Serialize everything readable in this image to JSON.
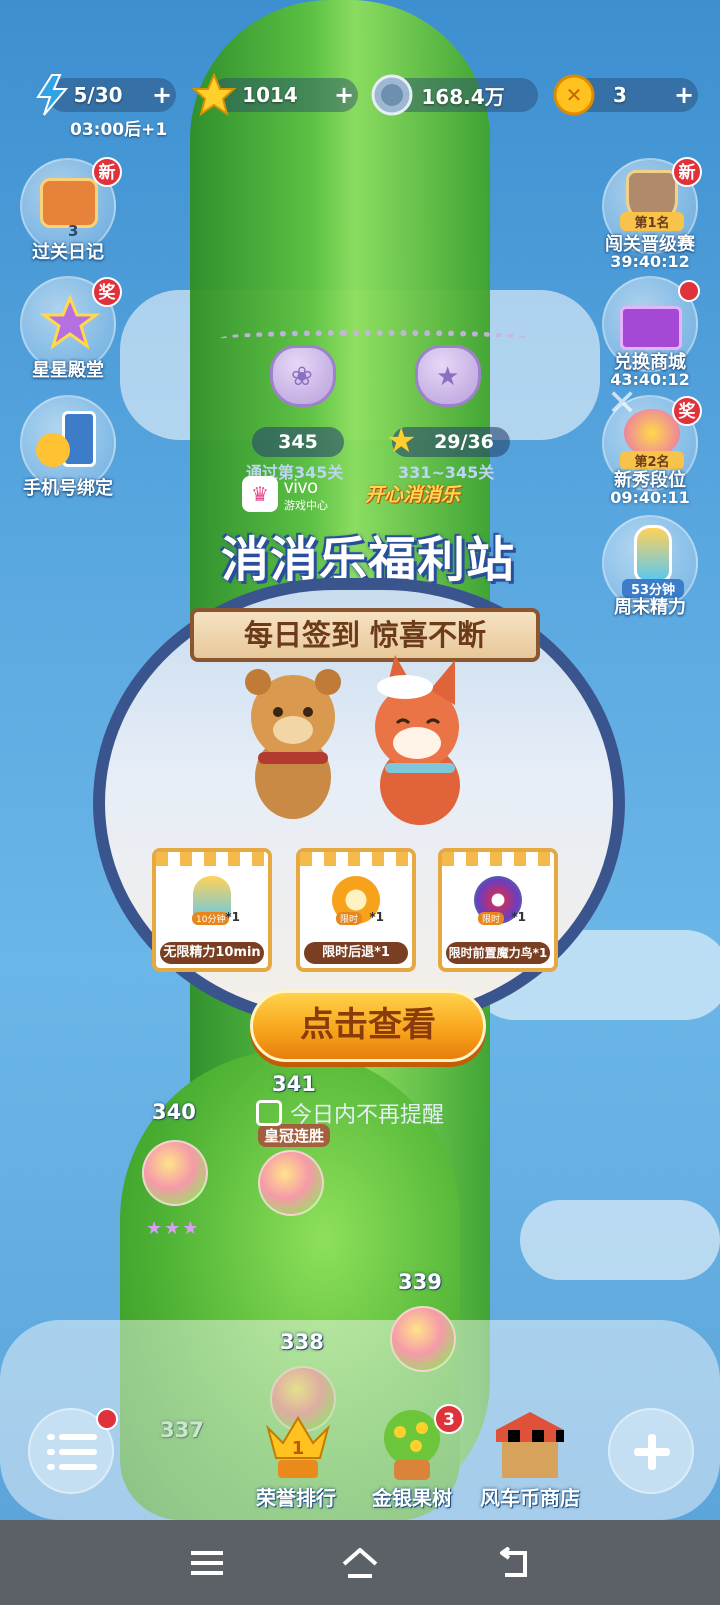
{
  "resources": {
    "energy": {
      "value": "5/30",
      "timer": "03:00后+1"
    },
    "stars": {
      "value": "1014"
    },
    "coins": {
      "value": "168.4万"
    },
    "tokens": {
      "value": "3"
    }
  },
  "left_buttons": [
    {
      "label": "过关日记",
      "badge": "新",
      "count": "3"
    },
    {
      "label": "星星殿堂",
      "badge": "奖"
    },
    {
      "label": "手机号绑定"
    }
  ],
  "right_buttons": [
    {
      "label": "闯关晋级赛",
      "badge": "新",
      "rank": "第1名",
      "timer": "39:40:12"
    },
    {
      "label": "兑换商城",
      "timer": "43:40:12"
    },
    {
      "label": "新秀段位",
      "badge": "奖",
      "rank": "第2名",
      "timer": "09:40:11"
    },
    {
      "label": "周末精力",
      "tag": "53分钟"
    }
  ],
  "locks": {
    "level": "345",
    "stars": "29/36",
    "caption_left": "通过第345关",
    "caption_right": "331~345关"
  },
  "popup": {
    "brand_name": "vivo",
    "brand_sub": "游戏中心",
    "game_logo": "开心消消乐",
    "title": "消消乐福利站",
    "banner": "每日签到 惊喜不断",
    "rewards": [
      {
        "label": "无限精力10min",
        "tag": "10分钟",
        "qty": "*1"
      },
      {
        "label": "限时后退*1",
        "tag": "限时",
        "qty": "*1"
      },
      {
        "label": "限时前置魔力鸟*1",
        "tag": "限时",
        "qty": "*1"
      }
    ],
    "cta": "点击查看",
    "remind": "今日内不再提醒"
  },
  "levels": {
    "l341": "341",
    "l340": "340",
    "l339": "339",
    "l338": "338",
    "l337": "337",
    "crown_tag": "皇冠连胜",
    "stars": "★★★"
  },
  "bottom": {
    "rank": "荣誉排行",
    "tree": "金银果树",
    "tree_badge": "3",
    "shop": "风车币商店"
  },
  "colors": {
    "accent": "#f7a21a",
    "badge": "#e0323a",
    "frame": "#3a558d"
  }
}
